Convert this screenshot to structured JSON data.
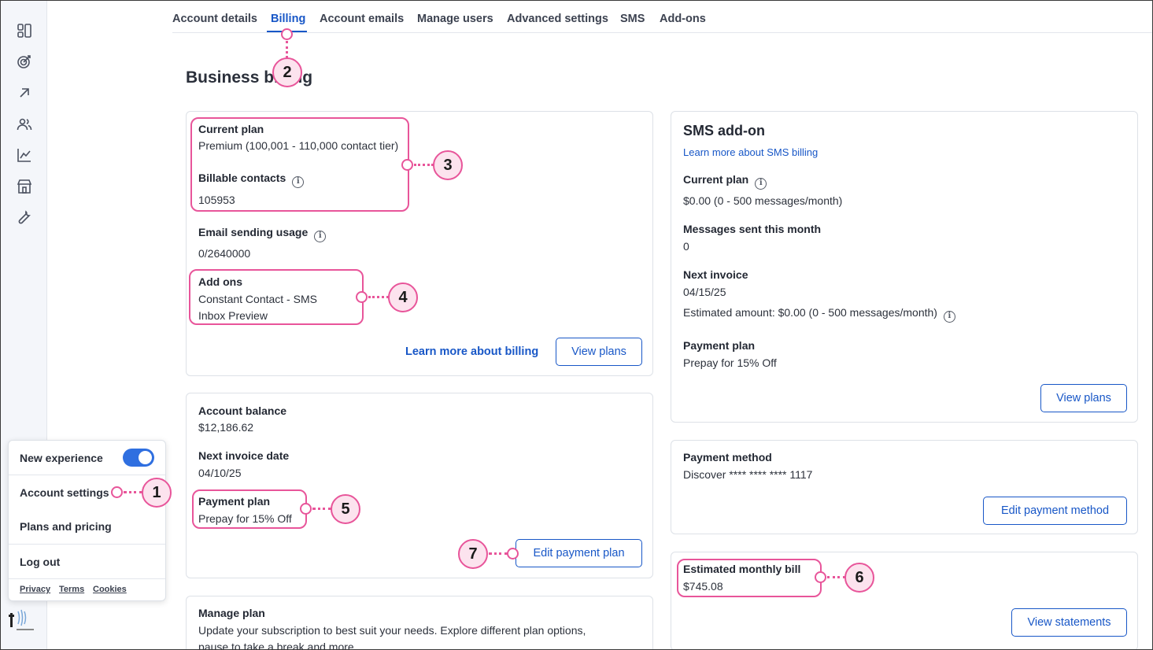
{
  "tabs": [
    "Account details",
    "Billing",
    "Account emails",
    "Manage users",
    "Advanced settings",
    "SMS",
    "Add-ons"
  ],
  "page_title": "Business billing",
  "rail_icons": [
    "dashboard-icon",
    "campaign-target-icon",
    "arrow-up-right-icon",
    "contacts-icon",
    "reporting-icon",
    "store-icon",
    "tools-wrench-icon"
  ],
  "plan_card": {
    "current_plan_label": "Current plan",
    "current_plan_value": "Premium (100,001 - 110,000 contact tier)",
    "billable_label": "Billable contacts",
    "billable_value": "105953",
    "usage_label": "Email sending usage",
    "usage_value": "0/2640000",
    "addons_label": "Add ons",
    "addons": [
      "Constant Contact - SMS",
      "Inbox Preview"
    ],
    "learn_more": "Learn more about billing",
    "view_plans": "View plans"
  },
  "balance_card": {
    "balance_label": "Account balance",
    "balance_value": "$12,186.62",
    "next_invoice_label": "Next invoice date",
    "next_invoice_value": "04/10/25",
    "payment_plan_label": "Payment plan",
    "payment_plan_value": "Prepay for 15% Off",
    "edit_button": "Edit payment plan"
  },
  "manage_card": {
    "title": "Manage plan",
    "desc1": "Update your subscription to best suit your needs. Explore different plan options,",
    "desc2": "pause to take a break and more."
  },
  "sms_card": {
    "title": "SMS add-on",
    "learn_more": "Learn more about SMS billing",
    "current_plan_label": "Current plan",
    "current_plan_value": "$0.00 (0 - 500 messages/month)",
    "messages_label": "Messages sent this month",
    "messages_value": "0",
    "next_invoice_label": "Next invoice",
    "next_invoice_value": "04/15/25",
    "estimated": "Estimated amount: $0.00 (0 - 500 messages/month)",
    "payment_plan_label": "Payment plan",
    "payment_plan_value": "Prepay for 15% Off",
    "view_plans": "View plans"
  },
  "payment_method_card": {
    "label": "Payment method",
    "value": "Discover **** **** **** 1117",
    "edit_button": "Edit payment method"
  },
  "monthly_card": {
    "label": "Estimated monthly bill",
    "value": "$745.08",
    "view_statements": "View statements"
  },
  "menu": {
    "new_experience": "New experience",
    "new_experience_on": true,
    "account_settings": "Account settings",
    "plans_pricing": "Plans and pricing",
    "log_out": "Log out",
    "privacy": "Privacy",
    "terms": "Terms",
    "cookies": "Cookies"
  },
  "callouts": [
    "1",
    "2",
    "3",
    "4",
    "5",
    "6",
    "7"
  ],
  "colors": {
    "accent": "#1857c7",
    "highlight": "#e8559a",
    "badge_fill": "#fce3ee"
  }
}
